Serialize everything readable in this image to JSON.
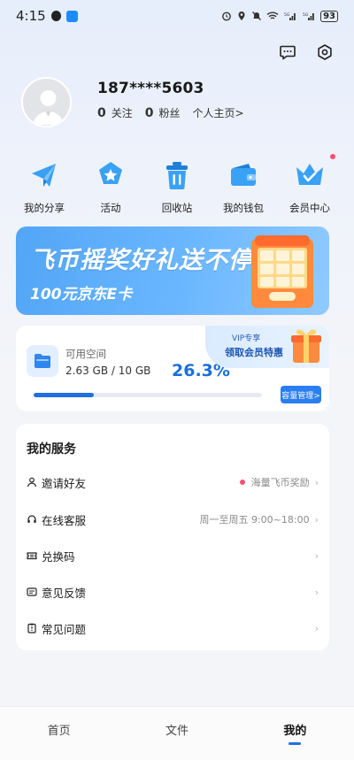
{
  "status_bar": {
    "time": "4:15",
    "battery": "93"
  },
  "profile": {
    "username": "187****5603",
    "following_count": "0",
    "following_label": "关注",
    "followers_count": "0",
    "followers_label": "粉丝",
    "homepage_link": "个人主页>"
  },
  "quick_menu": [
    {
      "label": "我的分享",
      "icon": "share-plane-icon"
    },
    {
      "label": "活动",
      "icon": "activity-star-icon"
    },
    {
      "label": "回收站",
      "icon": "recycle-bin-icon"
    },
    {
      "label": "我的钱包",
      "icon": "wallet-icon"
    },
    {
      "label": "会员中心",
      "icon": "vip-crown-icon"
    }
  ],
  "banner": {
    "title": "飞币摇奖好礼送不停",
    "subtitle": "100元京东E卡"
  },
  "storage": {
    "title": "可用空间",
    "used": "2.63 GB / 10 GB",
    "percent_label": "26.3%",
    "percent_value": 0.263,
    "vip_small": "VIP专享",
    "vip_main": "领取会员特惠",
    "manage_label": "容量管理>"
  },
  "services": {
    "title": "我的服务",
    "items": [
      {
        "label": "邀请好友",
        "right": "海量飞币奖励",
        "icon": "person-icon",
        "dot": true
      },
      {
        "label": "在线客服",
        "right": "周一至周五 9:00~18:00",
        "icon": "headset-icon",
        "dot": false
      },
      {
        "label": "兑换码",
        "right": "",
        "icon": "ticket-icon",
        "dot": false
      },
      {
        "label": "意见反馈",
        "right": "",
        "icon": "feedback-icon",
        "dot": false
      },
      {
        "label": "常见问题",
        "right": "",
        "icon": "question-icon",
        "dot": false
      }
    ]
  },
  "bottom_nav": [
    {
      "label": "首页"
    },
    {
      "label": "文件"
    },
    {
      "label": "我的"
    }
  ],
  "colors": {
    "accent": "#1f6fe0",
    "banner": "#5aaaf8",
    "badge": "#ff4d7a"
  }
}
